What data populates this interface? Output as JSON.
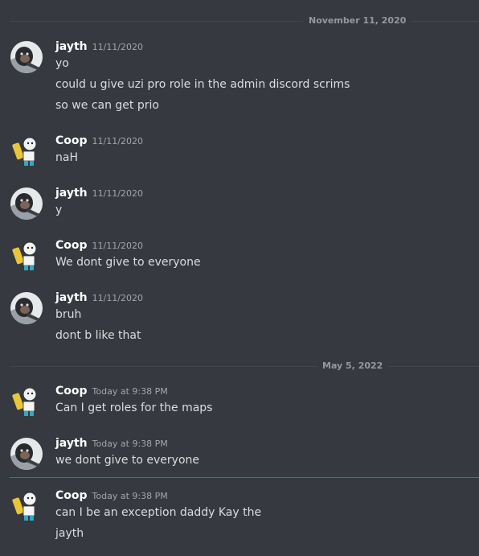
{
  "dividers": {
    "first": "November 11, 2020",
    "second": "May 5, 2022"
  },
  "users": {
    "jayth": {
      "name": "jayth",
      "avatar_icon": "monkey-avatar-icon"
    },
    "coop": {
      "name": "Coop",
      "avatar_icon": "cartoon-character-avatar-icon"
    }
  },
  "messages": [
    {
      "author": "jayth",
      "time": "11/11/2020",
      "lines": [
        "yo",
        "could u give uzi pro role in the admin discord scrims",
        "so we can get prio"
      ]
    },
    {
      "author": "Coop",
      "time": "11/11/2020",
      "lines": [
        "naH"
      ]
    },
    {
      "author": "jayth",
      "time": "11/11/2020",
      "lines": [
        "y"
      ]
    },
    {
      "author": "Coop",
      "time": "11/11/2020",
      "lines": [
        "We dont give to everyone"
      ]
    },
    {
      "author": "jayth",
      "time": "11/11/2020",
      "lines": [
        "bruh",
        "dont b like that"
      ]
    },
    {
      "author": "Coop",
      "time": "Today at 9:38 PM",
      "lines": [
        "Can I get roles for the maps"
      ]
    },
    {
      "author": "jayth",
      "time": "Today at 9:38 PM",
      "lines": [
        "we dont give to everyone"
      ]
    },
    {
      "author": "Coop",
      "time": "Today at 9:38 PM",
      "lines": [
        "can I be an exception daddy Kay the",
        "jayth"
      ]
    }
  ],
  "colors": {
    "background": "#36393f",
    "username": "#ffffff",
    "message_text": "#dcddde",
    "timestamp": "#a3a6aa",
    "new_messages_line": "#d13c3c"
  }
}
